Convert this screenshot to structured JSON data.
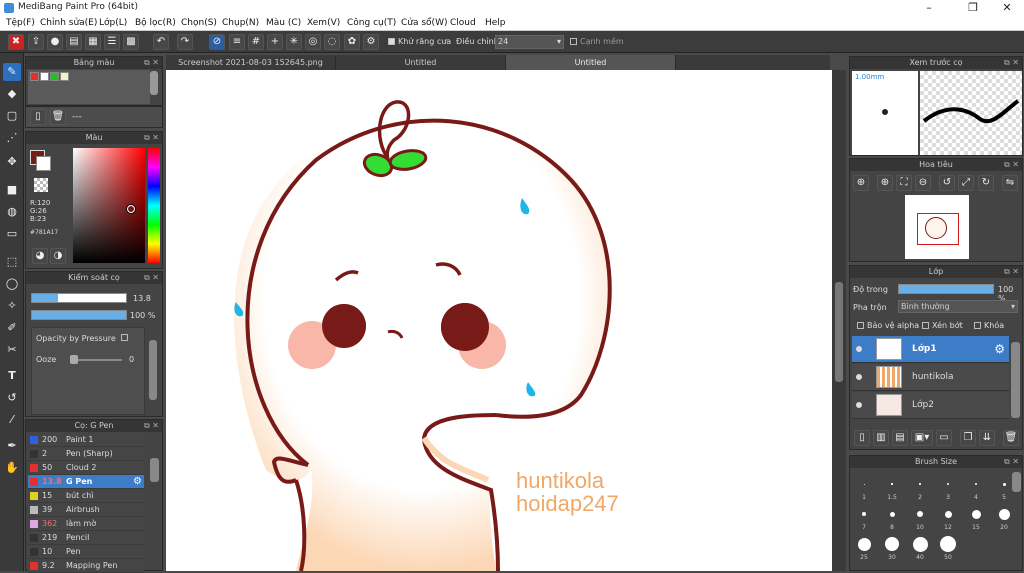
{
  "app": {
    "title": "MediBang Paint Pro (64bit)"
  },
  "menu": [
    "Tệp(F)",
    "Chỉnh sửa(E)",
    "Lớp(L)",
    "Bộ lọc(R)",
    "Chọn(S)",
    "Chụp(N)",
    "Màu (C)",
    "Xem(V)",
    "Công cụ(T)",
    "Cửa sổ(W)",
    "Cloud",
    "Help"
  ],
  "toolbar": {
    "antialias_label": "Khử răng cưa",
    "adjust_label": "Điều chỉnh",
    "adjust_value": "24",
    "snap_label": "Cạnh mềm"
  },
  "palette": {
    "title": "Bảng màu",
    "swatches": [
      "#e03030",
      "#ffffff",
      "#22c022",
      "#f3f0c8"
    ],
    "entry": "---"
  },
  "color": {
    "title": "Màu",
    "fg": "#781A17",
    "r": "R:120",
    "g": "G:26",
    "b": "B:23",
    "hex": "#781A17"
  },
  "brush_ctrl": {
    "title": "Kiểm soát cọ",
    "size": "13.8",
    "size_frac": 0.28,
    "opacity": "100 %",
    "opacity_frac": 1.0,
    "opacity_pressure": "Opacity by Pressure",
    "ooze": "Ooze",
    "ooze_value": "0"
  },
  "brush_list": {
    "title": "Cọ: G Pen",
    "items": [
      {
        "size": "200",
        "name": "Paint 1",
        "color": "#3060e0"
      },
      {
        "size": "2",
        "name": "Pen (Sharp)",
        "color": "#333333"
      },
      {
        "size": "50",
        "name": "Cloud 2",
        "color": "#e03030"
      },
      {
        "size": "13.8",
        "name": "G Pen",
        "color": "#e03030"
      },
      {
        "size": "15",
        "name": "bút chì",
        "color": "#e0d020"
      },
      {
        "size": "39",
        "name": "Airbrush",
        "color": "#bbbbbb"
      },
      {
        "size": "362",
        "name": "làm mờ",
        "color": "#e0a8e0"
      },
      {
        "size": "219",
        "name": "Pencil",
        "color": "#333333"
      },
      {
        "size": "10",
        "name": "Pen",
        "color": "#333333"
      },
      {
        "size": "9.2",
        "name": "Mapping Pen",
        "color": "#e03030"
      }
    ]
  },
  "tabs": [
    "Screenshot 2021-08-03 152645.png",
    "Untitled",
    "Untitled"
  ],
  "canvas": {
    "text1": "huntikola",
    "text2": "hoidap247"
  },
  "preview": {
    "title": "Xem trước cọ",
    "size": "1.00mm"
  },
  "navigator": {
    "title": "Hoa tiêu"
  },
  "layers": {
    "title": "Lớp",
    "opacity_label": "Độ trong",
    "opacity_value": "100 %",
    "blend_label": "Pha trộn",
    "blend_value": "Bình thường",
    "protect_alpha": "Bảo vệ alpha",
    "clip": "Xén bớt",
    "lock": "Khóa",
    "items": [
      {
        "name": "Lớp1"
      },
      {
        "name": "huntikola"
      },
      {
        "name": "Lớp2"
      }
    ]
  },
  "brush_size": {
    "title": "Brush Size",
    "labels": [
      "1",
      "1.5",
      "2",
      "3",
      "4",
      "5",
      "7",
      "8",
      "10",
      "12",
      "15",
      "20",
      "25",
      "30",
      "40",
      "50"
    ]
  }
}
